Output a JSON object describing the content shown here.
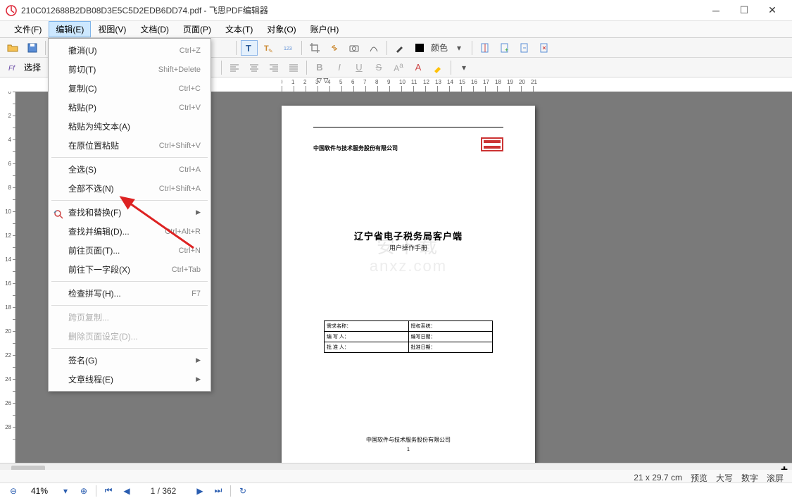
{
  "titlebar": {
    "filename": "210C012688B2DB08D3E5C5D2EDB6DD74.pdf",
    "appname": "飞思PDF编辑器"
  },
  "menubar": {
    "items": [
      {
        "label": "文件(F)"
      },
      {
        "label": "编辑(E)",
        "active": true
      },
      {
        "label": "视图(V)"
      },
      {
        "label": "文档(D)"
      },
      {
        "label": "页面(P)"
      },
      {
        "label": "文本(T)"
      },
      {
        "label": "对象(O)"
      },
      {
        "label": "账户(H)"
      }
    ]
  },
  "dropdown": {
    "items": [
      {
        "label": "撤消(U)",
        "shortcut": "Ctrl+Z"
      },
      {
        "label": "剪切(T)",
        "shortcut": "Shift+Delete"
      },
      {
        "label": "复制(C)",
        "shortcut": "Ctrl+C"
      },
      {
        "label": "粘贴(P)",
        "shortcut": "Ctrl+V"
      },
      {
        "label": "粘贴为纯文本(A)",
        "shortcut": ""
      },
      {
        "label": "在原位置粘贴",
        "shortcut": "Ctrl+Shift+V"
      },
      {
        "sep": true
      },
      {
        "label": "全选(S)",
        "shortcut": "Ctrl+A"
      },
      {
        "label": "全部不选(N)",
        "shortcut": "Ctrl+Shift+A"
      },
      {
        "sep": true
      },
      {
        "label": "查找和替换(F)",
        "shortcut": "",
        "sub": true
      },
      {
        "label": "查找并编辑(D)...",
        "shortcut": "Ctrl+Alt+R"
      },
      {
        "label": "前往页面(T)...",
        "shortcut": "Ctrl+N"
      },
      {
        "label": "前往下一字段(X)",
        "shortcut": "Ctrl+Tab"
      },
      {
        "sep": true
      },
      {
        "label": "检查拼写(H)...",
        "shortcut": "F7"
      },
      {
        "sep": true
      },
      {
        "label": "跨页复制...",
        "disabled": true
      },
      {
        "label": "删除页面设定(D)...",
        "disabled": true
      },
      {
        "sep": true
      },
      {
        "label": "签名(G)",
        "sub": true
      },
      {
        "label": "文章线程(E)",
        "sub": true
      }
    ]
  },
  "toolbar2": {
    "select_label": "选择",
    "color_label": "颜色"
  },
  "ruler": {
    "marks": [
      "1",
      "2",
      "3",
      "4",
      "5",
      "6",
      "7",
      "8",
      "9",
      "10",
      "11",
      "12",
      "13",
      "14",
      "15",
      "16",
      "17",
      "18",
      "19",
      "20"
    ]
  },
  "page": {
    "company": "中国软件与技术服务股份有限公司",
    "title1": "辽宁省电子税务局客户端",
    "title2": "用户操作手册",
    "table": {
      "row1a": "需求名称：",
      "row1b": "授权系统：",
      "row2a": "编 写 人：",
      "row2b": "编写日期：",
      "row3a": "批 准 人：",
      "row3b": "批准日期："
    },
    "pgnum": "1"
  },
  "watermark": {
    "line1": "安下载",
    "line2": "anxz.com"
  },
  "statusbar": {
    "dim": "21 x 29.7 cm",
    "preview": "预览",
    "caps": "大写",
    "num": "数字",
    "scroll": "滚屏"
  },
  "navbar": {
    "zoom": "41%",
    "page": "1 / 362"
  }
}
